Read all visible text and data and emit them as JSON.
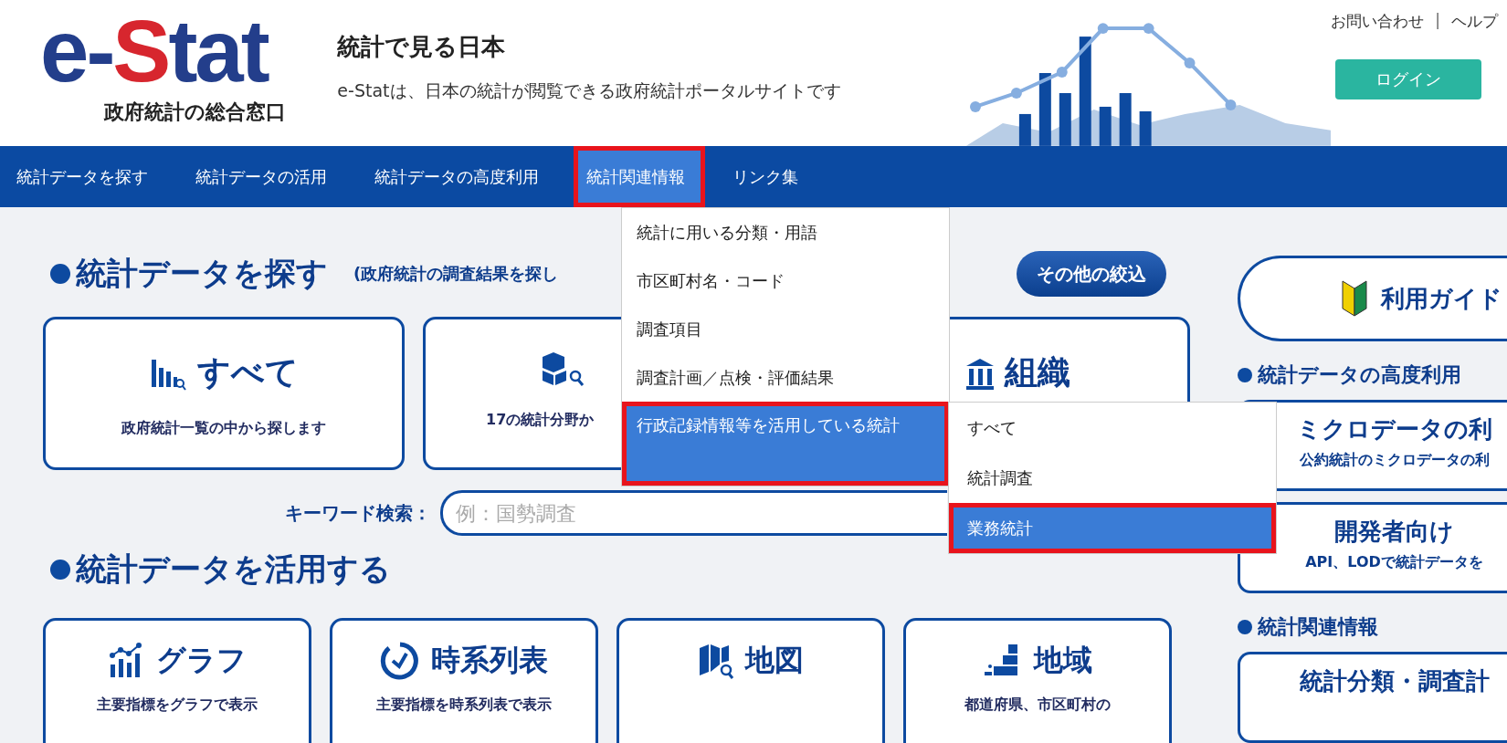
{
  "header": {
    "logo": [
      {
        "text": "e-",
        "accent": false
      },
      {
        "text": "S",
        "accent": true
      },
      {
        "text": "tat",
        "accent": false
      }
    ],
    "logo_subtitle": "政府統計の総合窓口",
    "title": "統計で見る日本",
    "tagline": "e-Statは、日本の統計が閲覧できる政府統計ポータルサイトです",
    "links": [
      "お問い合わせ",
      "|",
      "ヘルプ"
    ],
    "login_button": "ログイン"
  },
  "nav": [
    {
      "label": "統計データを探す",
      "selected": false,
      "highlighted": false
    },
    {
      "label": "統計データの活用",
      "selected": false,
      "highlighted": false
    },
    {
      "label": "統計データの高度利用",
      "selected": false,
      "highlighted": false
    },
    {
      "label": "統計関連情報",
      "selected": true,
      "highlighted": true
    },
    {
      "label": "リンク集",
      "selected": false,
      "highlighted": false
    }
  ],
  "dropdown": [
    {
      "label": "統計に用いる分類・用語",
      "selected": false,
      "highlighted": false
    },
    {
      "label": "市区町村名・コード",
      "selected": false,
      "highlighted": false
    },
    {
      "label": "調査項目",
      "selected": false,
      "highlighted": false
    },
    {
      "label": "調査計画／点検・評価結果",
      "selected": false,
      "highlighted": false
    },
    {
      "label": "行政記録情報等を活用している統計",
      "selected": true,
      "highlighted": true
    }
  ],
  "submenu": [
    {
      "label": "すべて",
      "selected": false,
      "highlighted": false
    },
    {
      "label": "統計調査",
      "selected": false,
      "highlighted": false
    },
    {
      "label": "業務統計",
      "selected": true,
      "highlighted": true
    }
  ],
  "search_section": {
    "heading": "統計データを探す",
    "subheading": "(政府統計の調査結果を探し",
    "filter_button": "その他の絞込",
    "cards": [
      {
        "kind": "bars",
        "title": "すべて",
        "description": "政府統計一覧の中から探します"
      },
      {
        "kind": "cubes",
        "description": "17の統計分野か"
      },
      {
        "kind": "building",
        "title": "組織"
      }
    ],
    "keyword_label": "キーワード検索：",
    "keyword_placeholder": "例：国勢調査"
  },
  "use_section": {
    "heading": "統計データを活用する",
    "cards": [
      {
        "kind": "graph",
        "title": "グラフ",
        "description": "主要指標をグラフで表示"
      },
      {
        "kind": "clock",
        "title": "時系列表",
        "description": "主要指標を時系列表で表示"
      },
      {
        "kind": "map",
        "title": "地図"
      },
      {
        "kind": "region",
        "title": "地域",
        "description": "都道府県、市区町村の"
      }
    ]
  },
  "sidebar": {
    "guide_button": "利用ガイド",
    "groups": [
      {
        "heading": "統計データの高度利用",
        "cards": [
          {
            "title": "ミクロデータの利",
            "description": "公約統計のミクロデータの利"
          },
          {
            "title": "開発者向け",
            "description": "API、LODで統計データを"
          }
        ]
      },
      {
        "heading": "統計関連情報",
        "cards": [
          {
            "title": "統計分類・調査計"
          }
        ]
      }
    ]
  }
}
